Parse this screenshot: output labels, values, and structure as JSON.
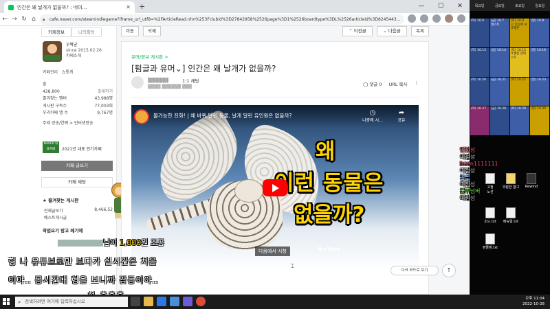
{
  "browser": {
    "tab_title": "인간은 왜 날개가 없을까? : 네이…",
    "url": "cafe.naver.com/steamindiegame?iframe_url_utf8=%2FArticleRead.nhn%253Fclubid%3D27842958%2526page%3D1%2526boardtype%3DL%2526articleid%3D8245443..."
  },
  "sidebar": {
    "tabs": [
      "카페정보",
      "나의활동"
    ],
    "profile_name": "우왁굳",
    "profile_since": "since 2015.02.26",
    "profile_sub": "카페소개",
    "links": [
      "카페관리",
      "쇼통계"
    ],
    "grade_label": "숲",
    "member_count": "428,800",
    "stats": [
      {
        "label": "즐겨찾는 멤버",
        "value": "43,988명"
      },
      {
        "label": "게시판 구독수",
        "value": "77,003회"
      },
      {
        "label": "우리카페 앱 수",
        "value": "9,767명"
      }
    ],
    "theme_label": "주제 방송/연예 > 인터넷방송",
    "award_badge": "NAVER 대표카페",
    "award_text": "2021년 대표 인기카페",
    "write_btn": "카페 글쓰기",
    "chat_btn": "카페 채팅",
    "fav_section": "즐겨찾는 게시판",
    "fav_rows": [
      {
        "label": "전체글보기",
        "value": "8,466,52"
      },
      {
        "label": "베스트게시글",
        "value": ""
      }
    ],
    "section2": "작업요기 방고 메기에"
  },
  "article": {
    "top_buttons": {
      "edit": "이동",
      "delete": "삭제",
      "prev": "이전글",
      "next": "다음글",
      "list": "목록"
    },
    "category": "유머/정보 게시판 >",
    "title": "[펌글과 유머⌄] 인간은 왜 날개가 없을까?",
    "level": "1:1 채팅",
    "comments": "댓글 0",
    "copy_url": "URL 복사",
    "more": "⋮"
  },
  "video": {
    "title": "불가능한 진화! | 왜 바퀴 달린 동물, 날개 달린 유인원은 없을까?",
    "later": "나중에 시...",
    "share": "공유",
    "line1": "왜",
    "line2": "이런 동물은",
    "line3": "없을까?",
    "watch_on": "다음에서 시청",
    "yt": "YouTube"
  },
  "page_buttons": {
    "dark_mode": "다크 모드로 보기",
    "top": "↑"
  },
  "overlay": {
    "donation_suffix": "님이 ",
    "donation_amount": "1,000",
    "donation_unit": "원 조공",
    "subtitle1": "형 나 유튜브로만 보다가 실시간은 처음",
    "subtitle2": "이야.. 몽시간대 형을 보니까 감동이야..",
    "subtitle3": "형   흑흑흑"
  },
  "right_panel": {
    "head": [
      "목요일",
      "금요일",
      "토요일",
      "일요일"
    ],
    "days": [
      "목요일",
      "금요일",
      "토요일",
      "일요일"
    ],
    "cells": [
      {
        "text": "(목) 10.6",
        "color": "#2f4d8a"
      },
      {
        "text": "(금) 10.7\n테스트",
        "color": "#3e5fa8"
      },
      {
        "text": "(토) 10.8\n고 현장에 서 포켓몬",
        "color": "#c9a000"
      },
      {
        "text": "(일) 10.9",
        "color": "#3e5fa8"
      },
      {
        "text": "(목) 10.13",
        "color": "#2f4d8a"
      },
      {
        "text": "(금) 10.14",
        "color": "#3e5fa8"
      },
      {
        "text": "(토) 10.15\n포켓몬 콘테스트",
        "color": "#e2bd1e"
      },
      {
        "text": "(일) 10.16",
        "color": "#3e5fa8"
      },
      {
        "text": "(목) 10.20",
        "color": "#2f4d8a"
      },
      {
        "text": "(금) 10.21",
        "color": "#3e5fa8"
      },
      {
        "text": "(토) 10.22",
        "color": "#c9a000"
      },
      {
        "text": "(일) 10.23",
        "color": "#3e5fa8"
      },
      {
        "text": "(목) 10.27",
        "color": "#8a2b6e"
      },
      {
        "text": "(금) 10.28",
        "color": "#2f4d8a"
      },
      {
        "text": "(토) 10.29",
        "color": "#3e5fa8"
      },
      {
        "text": "(일) 10.30",
        "color": "#c9a000"
      }
    ],
    "chat": [
      {
        "text": "인천성",
        "color": "#ff5a5a"
      },
      {
        "text": "이정성",
        "color": "#bbbbbb"
      },
      {
        "text": "been1111111",
        "color": "#ff4d6d"
      },
      {
        "text": "이정성",
        "color": "#bbbbbb"
      },
      {
        "text": "동금",
        "color": "#4da3ff"
      },
      {
        "text": "이정성",
        "color": "#bbbbbb"
      },
      {
        "text": "불뮤넘버",
        "color": "#7cdb5a"
      },
      {
        "text": "이정성",
        "color": "#bbbbbb"
      }
    ],
    "desktop_icons": [
      {
        "label": "고정\n노선",
        "style": "white"
      },
      {
        "label": "우렁한 합그",
        "style": "yellow"
      },
      {
        "label": "Rewind",
        "style": "dark"
      },
      {
        "label": "소드.txt",
        "style": "white"
      },
      {
        "label": "메뉴얼.txt",
        "style": "white"
      },
      {
        "label": "편플랜.txt",
        "style": "white"
      }
    ]
  },
  "taskbar": {
    "search_placeholder": "검색하려면 여기에 입력하십시오",
    "time": "오후 11:04",
    "date": "2022-10-28"
  }
}
